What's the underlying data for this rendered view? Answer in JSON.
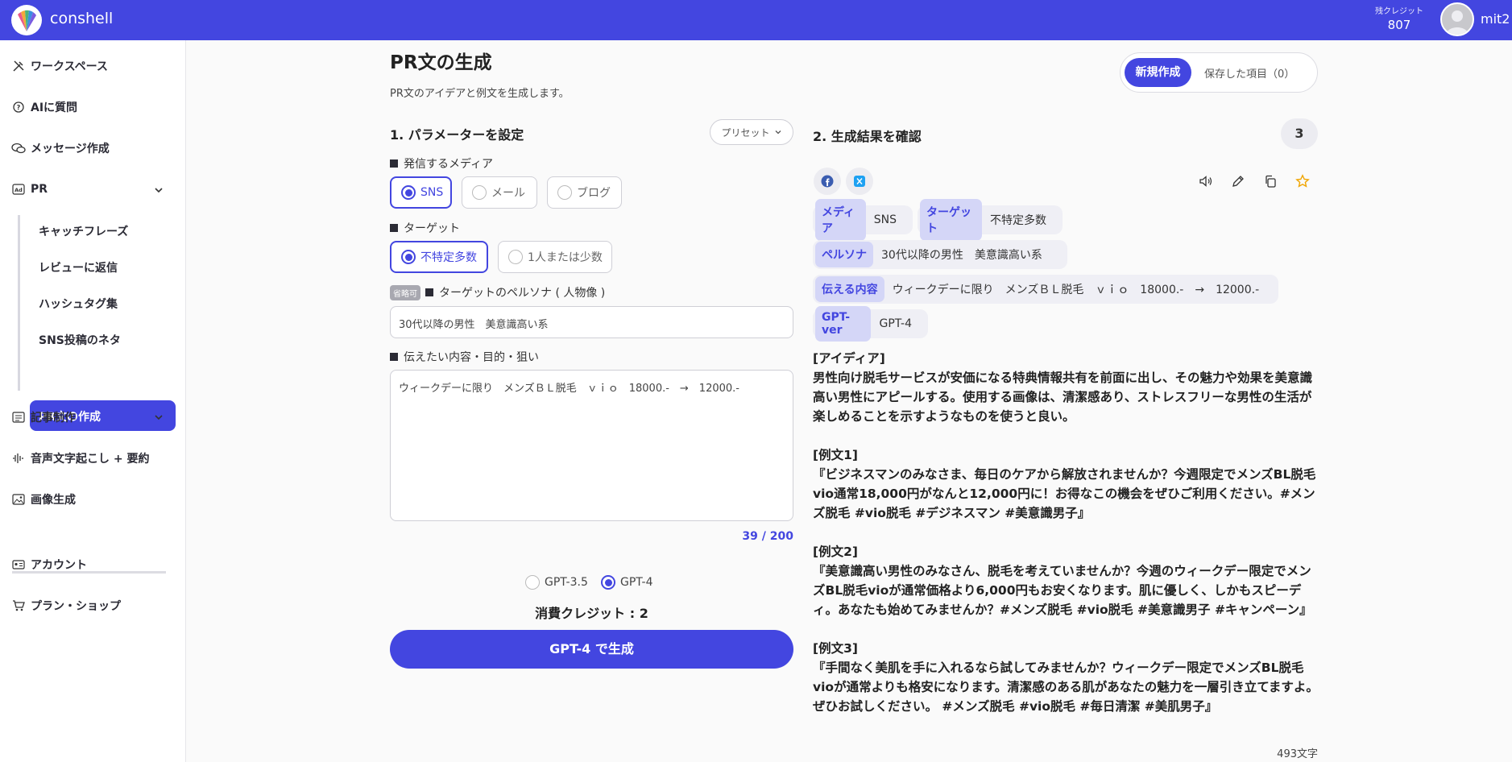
{
  "app": {
    "brand": "conshell",
    "credit_label": "残クレジット",
    "credit_value": "807",
    "username": "mit2"
  },
  "sidebar": {
    "items": [
      {
        "label": "ワークスペース",
        "icon": "tools-icon"
      },
      {
        "label": "AIに質問",
        "icon": "chat-question-icon"
      },
      {
        "label": "メッセージ作成",
        "icon": "chat-bubbles-icon"
      },
      {
        "label": "PR",
        "icon": "ad-icon"
      },
      {
        "label": "記事制作",
        "icon": "article-icon"
      },
      {
        "label": "音声文字起こし + 要約",
        "icon": "voice-icon"
      },
      {
        "label": "画像生成",
        "icon": "image-icon"
      },
      {
        "label": "アカウント",
        "icon": "id-card-icon"
      },
      {
        "label": "プラン・ショップ",
        "icon": "cart-icon"
      }
    ],
    "pr_sub": [
      "キャッチフレーズ",
      "レビューに返信",
      "ハッシュタグ集",
      "SNS投稿のネタ",
      "PR文の作成"
    ]
  },
  "page": {
    "title": "PR文の生成",
    "subtitle": "PR文のアイデアと例文を生成します。",
    "tab_new": "新規作成",
    "tab_saved": "保存した項目（0）"
  },
  "params": {
    "section_title": "1. パラメーターを設定",
    "preset_label": "プリセット",
    "media_label": "発信するメディア",
    "media_options": [
      "SNS",
      "メール",
      "ブログ"
    ],
    "target_label": "ターゲット",
    "target_options": [
      "不特定多数",
      "1人または少数"
    ],
    "optional_badge": "省略可",
    "persona_label": "ターゲットのペルソナ ( 人物像 )",
    "persona_value": "30代以降の男性　美意識高い系",
    "content_label": "伝えたい内容・目的・狙い",
    "content_value": "ウィークデーに限り　メンズＢＬ脱毛　ｖｉｏ　18000.-　→　12000.-",
    "counter": "39 / 200",
    "model_options": [
      "GPT-3.5",
      "GPT-4"
    ],
    "cost_text": "消費クレジット : 2",
    "generate_label": "GPT-4 で生成"
  },
  "results": {
    "section_title": "2. 生成結果を確認",
    "count": "3",
    "chips": {
      "media_key": "メディア",
      "media_val": "SNS",
      "target_key": "ターゲット",
      "target_val": "不特定多数",
      "persona_key": "ペルソナ",
      "persona_val": "30代以降の男性　美意識高い系",
      "content_key": "伝える内容",
      "content_val": "ウィークデーに限り　メンズＢＬ脱毛　ｖｉｏ　18000.-　→　12000.-",
      "gpt_key": "GPT-ver",
      "gpt_val": "GPT-4"
    },
    "idea_head": "[アイディア]",
    "idea_text": "男性向け脱毛サービスが安価になる特典情報共有を前面に出し、その魅力や効果を美意識高い男性にアピールする。使用する画像は、清潔感あり、ストレスフリーな男性の生活が楽しめることを示すようなものを使うと良い。",
    "ex1_head": "[例文1]",
    "ex1_text": "『ビジネスマンのみなさま、毎日のケアから解放されませんか？今週限定でメンズBL脱毛vio通常18,000円がなんと12,000円に！お得なこの機会をぜひご利用ください。#メンズ脱毛 #vio脱毛 #デジネスマン #美意識男子』",
    "ex2_head": "[例文2]",
    "ex2_text": "『美意識高い男性のみなさん、脱毛を考えていませんか？今週のウィークデー限定でメンズBL脱毛vioが通常価格より6,000円もお安くなります。肌に優しく、しかもスピーディ。あなたも始めてみませんか？#メンズ脱毛 #vio脱毛 #美意識男子 #キャンペーン』",
    "ex3_head": "[例文3]",
    "ex3_text": "『手間なく美肌を手に入れるなら試してみませんか？ウィークデー限定でメンズBL脱毛vioが通常よりも格安になります。清潔感のある肌があなたの魅力を一層引き立てますよ。ぜひお試しください。 #メンズ脱毛 #vio脱毛 #毎日清潔 #美肌男子』",
    "char_count": "493文字"
  },
  "colors": {
    "accent": "#4346e0",
    "chip_bg": "#d4d6f7",
    "star": "#f0a500"
  }
}
